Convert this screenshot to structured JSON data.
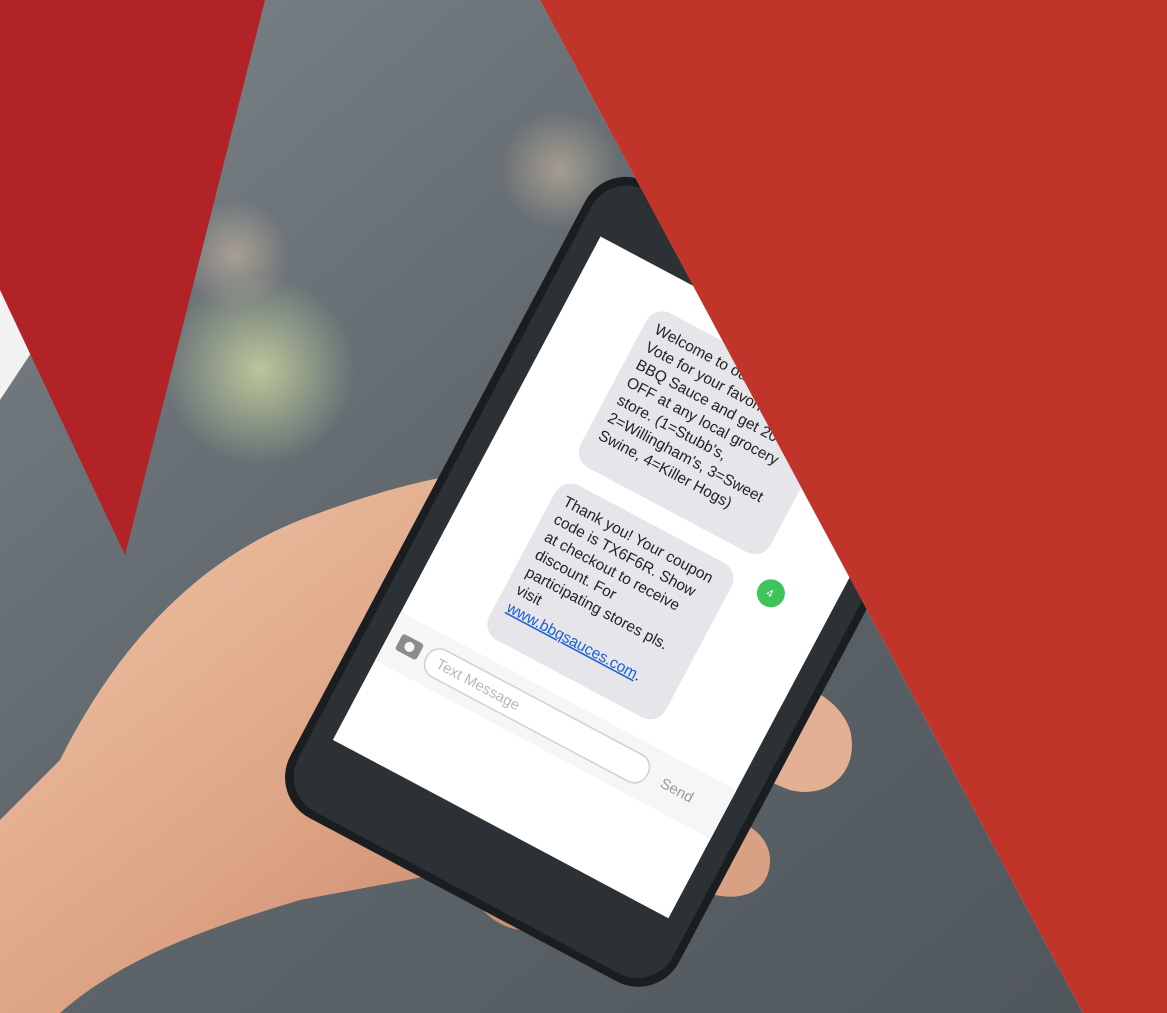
{
  "colors": {
    "accent_red": "#c0342a",
    "dark_red": "#b22327",
    "light_bg": "#f2f2f2",
    "photo_bg": "#6b7378",
    "bubble_gray": "#e6e6ea",
    "badge_green": "#3ec45a"
  },
  "messages": {
    "incoming_1": {
      "lines": [
        "Welcome to our poll!",
        "Vote for your favorite",
        "BBQ Sauce and get 20%",
        "OFF at any local grocery",
        "store. (1=Stubb's,",
        "2=Willingham's, 3=Sweet",
        "Swine, 4=Killer Hogs)"
      ]
    },
    "outgoing_reply": "4",
    "incoming_2": {
      "lines": [
        "Thank you! Your coupon",
        "code is TX6F6R. Show",
        "at checkout to receive",
        "discount. For",
        "participating stores pls.",
        "visit"
      ],
      "link": "www.bbqsauces.com",
      "link_suffix": "."
    }
  },
  "composer": {
    "placeholder": "Text Message",
    "send_label": "Send",
    "camera_icon": "camera-icon"
  }
}
